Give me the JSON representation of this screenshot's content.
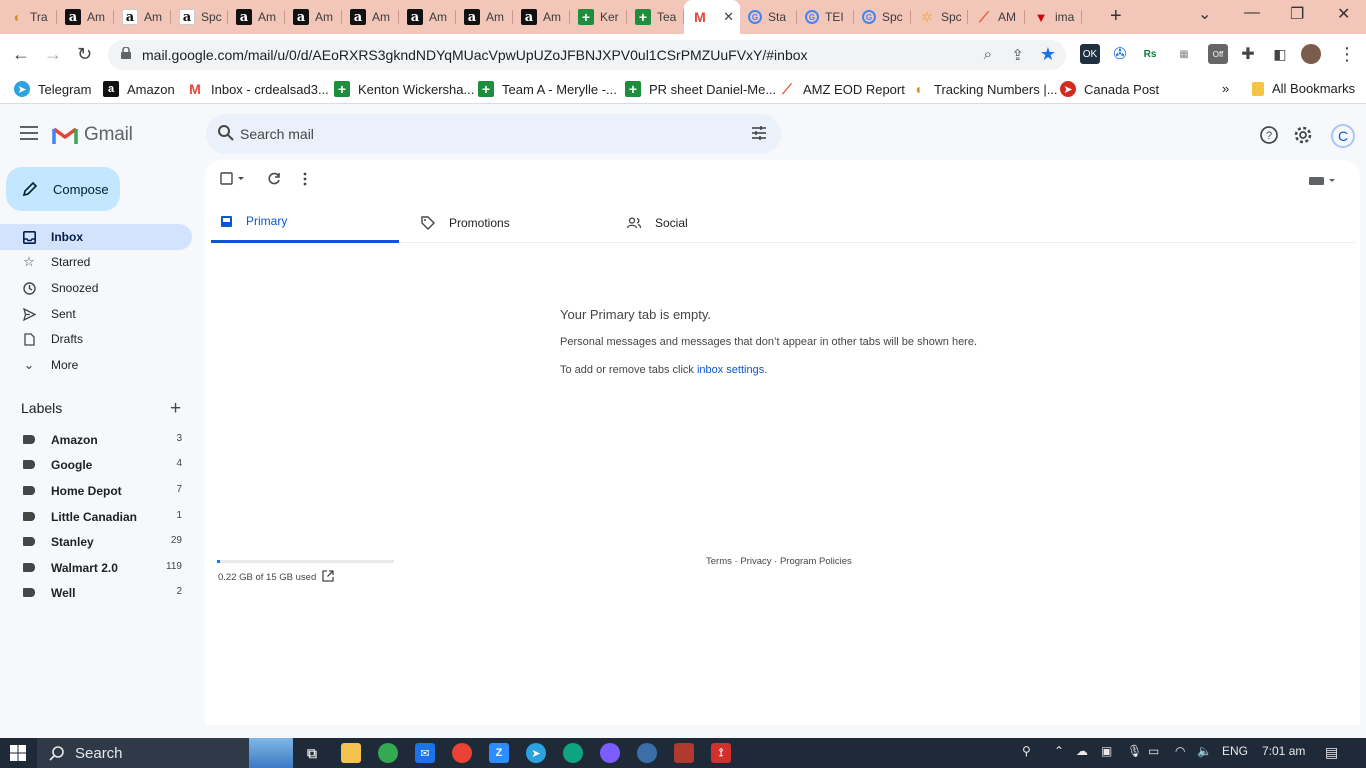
{
  "browser": {
    "tabs": [
      {
        "label": "Tra",
        "icon": "taco-icon"
      },
      {
        "label": "Am",
        "icon": "amazon-icon"
      },
      {
        "label": "Am",
        "icon": "amazon-icon"
      },
      {
        "label": "Spc",
        "icon": "amazon-icon"
      },
      {
        "label": "Am",
        "icon": "amazon-icon"
      },
      {
        "label": "Am",
        "icon": "amazon-icon"
      },
      {
        "label": "Am",
        "icon": "amazon-icon"
      },
      {
        "label": "Am",
        "icon": "amazon-icon"
      },
      {
        "label": "Am",
        "icon": "amazon-icon"
      },
      {
        "label": "Am",
        "icon": "amazon-icon"
      },
      {
        "label": "Ker",
        "icon": "sheets-icon"
      },
      {
        "label": "Tea",
        "icon": "sheets-icon"
      },
      {
        "label": "",
        "icon": "gmail-icon",
        "active": true
      },
      {
        "label": "Sta",
        "icon": "google-icon"
      },
      {
        "label": "TEI",
        "icon": "google-icon"
      },
      {
        "label": "Spc",
        "icon": "google-icon"
      },
      {
        "label": "Spc",
        "icon": "star-icon"
      },
      {
        "label": "AM",
        "icon": "amz-eod-icon"
      },
      {
        "label": "ima",
        "icon": "canadian-tire-icon"
      }
    ],
    "url": "mail.google.com/mail/u/0/d/AEoRXRS3gkndNDYqMUacVpwUpUZoJFBNJXPV0ul1CSrPMZUuFVxY/#inbox",
    "bookmarks": [
      {
        "label": "Telegram"
      },
      {
        "label": "Amazon"
      },
      {
        "label": "Inbox - crdealsad3..."
      },
      {
        "label": "Kenton Wickersha..."
      },
      {
        "label": "Team A - Merylle -..."
      },
      {
        "label": "PR sheet Daniel-Me..."
      },
      {
        "label": "AMZ EOD Report"
      },
      {
        "label": "Tracking Numbers |..."
      },
      {
        "label": "Canada Post"
      }
    ],
    "all_bookmarks": "All Bookmarks",
    "ext_ok": "OK",
    "ext_off": "Off",
    "ext_rs": "Rs"
  },
  "gmail": {
    "logo_text": "Gmail",
    "search_placeholder": "Search mail",
    "compose": "Compose",
    "nav": [
      {
        "label": "Inbox",
        "icon": "inbox-icon"
      },
      {
        "label": "Starred",
        "icon": "star-icon"
      },
      {
        "label": "Snoozed",
        "icon": "clock-icon"
      },
      {
        "label": "Sent",
        "icon": "send-icon"
      },
      {
        "label": "Drafts",
        "icon": "draft-icon"
      },
      {
        "label": "More",
        "icon": "chevron-down-icon"
      }
    ],
    "labels_title": "Labels",
    "labels": [
      {
        "name": "Amazon",
        "count": "3"
      },
      {
        "name": "Google",
        "count": "4"
      },
      {
        "name": "Home Depot",
        "count": "7"
      },
      {
        "name": "Little Canadian",
        "count": "1"
      },
      {
        "name": "Stanley",
        "count": "29"
      },
      {
        "name": "Walmart 2.0",
        "count": "119"
      },
      {
        "name": "Well",
        "count": "2"
      }
    ],
    "tabs": [
      {
        "label": "Primary",
        "active": true
      },
      {
        "label": "Promotions"
      },
      {
        "label": "Social"
      }
    ],
    "empty": {
      "title": "Your Primary tab is empty.",
      "subtitle": "Personal messages and messages that don’t appear in other tabs will be shown here.",
      "settings_prefix": "To add or remove tabs click ",
      "settings_link": "inbox settings",
      "settings_suffix": "."
    },
    "storage": {
      "text": "0.22 GB of 15 GB used",
      "used_fraction": 0.015
    },
    "footer": {
      "terms": "Terms",
      "sep": " · ",
      "privacy": "Privacy",
      "policies": "Program Policies"
    },
    "avatar_letter": "C"
  },
  "taskbar": {
    "search": "Search",
    "lang": "ENG",
    "time": "7:01 am"
  },
  "colors": {
    "accent": "#0b57d0",
    "compose_bg": "#c2e7ff",
    "active_nav": "#d3e3fd",
    "tabstrip": "#f2c6b8"
  }
}
